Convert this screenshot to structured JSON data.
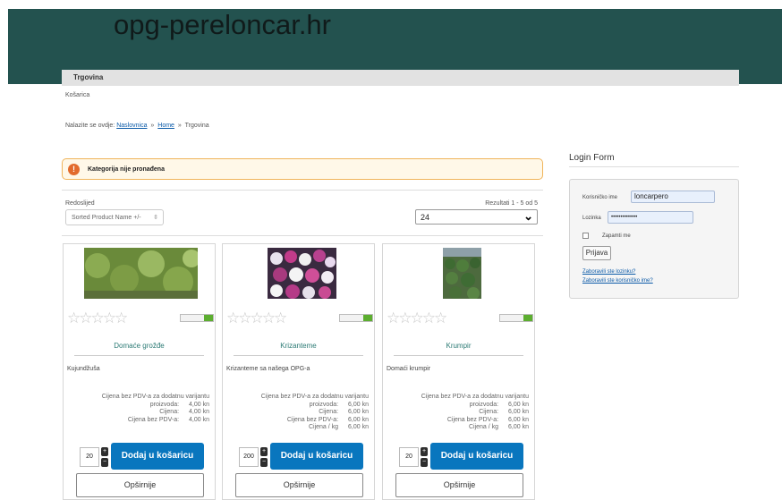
{
  "site": {
    "title": "opg-pereloncar.hr"
  },
  "menu": {
    "item": "Trgovina"
  },
  "submenu": {
    "item": "Košarica"
  },
  "breadcrumb": {
    "prefix": "Nalazite se ovdje:",
    "items": [
      "Naslovnica",
      "Home",
      "Trgovina"
    ],
    "separator": "»"
  },
  "alert": {
    "message": "Kategorija nije pronađena",
    "icon": "exclamation-circle-icon"
  },
  "listing": {
    "order_label": "Redoslijed",
    "order_value": "Sorted Product Name +/-",
    "results_text": "Rezultati 1 - 5 od 5",
    "limit_value": "24"
  },
  "products": [
    {
      "name": "Domaće grožđe",
      "desc": "Kujundžuša",
      "variant_label": "Cijena bez PDV-a za dodatnu varijantu",
      "prices": [
        {
          "label": "proizvoda:",
          "value": "4,00 kn"
        },
        {
          "label": "Cijena:",
          "value": "4,00 kn"
        },
        {
          "label": "Cijena bez PDV-a:",
          "value": "4,00 kn"
        }
      ],
      "qty": "20",
      "add_label": "Dodaj u košaricu",
      "more_label": "Opširnije"
    },
    {
      "name": "Krizanteme",
      "desc": "Krizanteme sa našega OPG-a",
      "variant_label": "Cijena bez PDV-a za dodatnu varijantu",
      "prices": [
        {
          "label": "proizvoda:",
          "value": "6,00 kn"
        },
        {
          "label": "Cijena:",
          "value": "6,00 kn"
        },
        {
          "label": "Cijena bez PDV-a:",
          "value": "6,00 kn"
        },
        {
          "label": "Cijena / kg",
          "value": "6,00 kn"
        }
      ],
      "qty": "200",
      "add_label": "Dodaj u košaricu",
      "more_label": "Opširnije"
    },
    {
      "name": "Krumpir",
      "desc": "Domaći krumpir",
      "variant_label": "Cijena bez PDV-a za dodatnu varijantu",
      "prices": [
        {
          "label": "proizvoda:",
          "value": "6,00 kn"
        },
        {
          "label": "Cijena:",
          "value": "6,00 kn"
        },
        {
          "label": "Cijena bez PDV-a:",
          "value": "6,00 kn"
        },
        {
          "label": "Cijena / kg",
          "value": "6,00 kn"
        }
      ],
      "qty": "20",
      "add_label": "Dodaj u košaricu",
      "more_label": "Opširnije"
    }
  ],
  "login": {
    "title": "Login Form",
    "username_label": "Korisničko ime",
    "username_value": "loncarpero",
    "password_label": "Lozinka",
    "password_value": "••••••••••••••",
    "remember_label": "Zapamti me",
    "submit_label": "Prijava",
    "forgot_password": "Zaboravili ste lozinku?",
    "forgot_username": "Zaboravili ste korisničko ime?"
  },
  "colors": {
    "header": "#23524f",
    "button": "#0976be",
    "alert_border": "#f0b45a",
    "link": "#0b5aa8",
    "accent_green": "#5cae2f"
  }
}
